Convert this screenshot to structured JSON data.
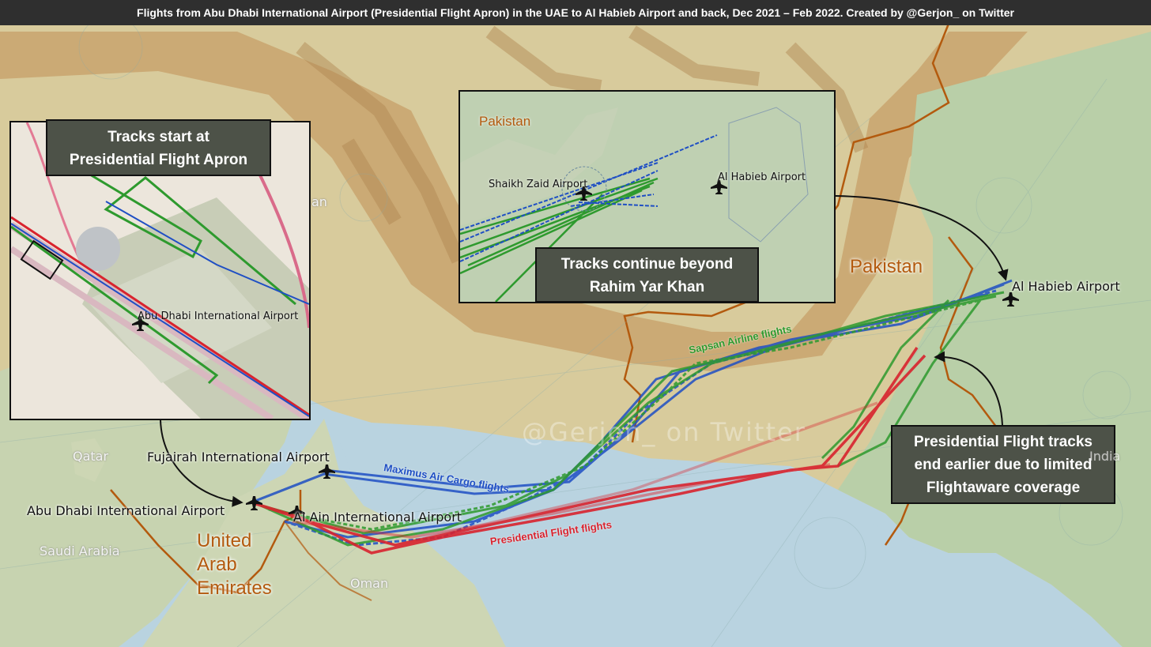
{
  "title": "Flights from Abu Dhabi International Airport (Presidential Flight Apron) in the UAE to Al Habieb Airport and back, Dec 2021 – Feb 2022. Created by @Gerjon_ on Twitter",
  "watermark": "@Gerjon_ on Twitter",
  "airports": {
    "abu_dhabi": "Abu Dhabi International Airport",
    "al_ain": "Al Ain International Airport",
    "fujairah": "Fujairah International Airport",
    "al_habieb": "Al Habieb Airport"
  },
  "countries": {
    "pakistan": "Pakistan",
    "uae": "United\nArab\nEmirates",
    "oman": "Oman",
    "qatar": "Qatar",
    "saudi": "Saudi Arabia",
    "india": "India",
    "iran_fragment": "an"
  },
  "route_labels": {
    "sapsan": "Sapsan Airline flights",
    "maximus": "Maximus Air Cargo flights",
    "presidential": "Presidential Flight flights"
  },
  "callouts": {
    "start": "Tracks start at\nPresidential Flight Apron",
    "continue": "Tracks continue beyond\nRahim Yar Khan",
    "end": "Presidential Flight tracks\nend earlier due to limited\nFlightaware coverage"
  },
  "inset_left": {
    "airport_label": "Abu Dhabi International Airport"
  },
  "inset_right": {
    "country": "Pakistan",
    "shaikh_zaid": "Shaikh Zaid Airport",
    "al_habieb": "Al Habieb Airport"
  },
  "colors": {
    "sapsan": "#2e9a2e",
    "maximus": "#1f4fc4",
    "presidential": "#d9232e",
    "border": "#b35a0e",
    "sea": "#b9d3e0",
    "callout_bg": "#4d5248"
  },
  "icons": [
    "airplane-icon"
  ]
}
